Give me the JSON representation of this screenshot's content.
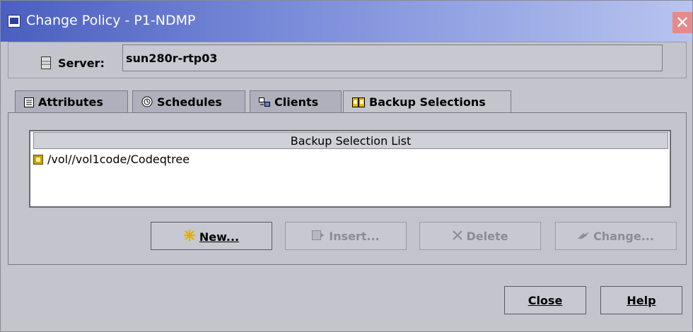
{
  "window": {
    "title": "Change Policy - P1-NDMP",
    "close_glyph": "✕"
  },
  "server": {
    "label": "Server:",
    "value": "sun280r-rtp03",
    "icon": "server-icon"
  },
  "tabs": [
    {
      "label": "Attributes",
      "icon": "attributes-icon",
      "active": false
    },
    {
      "label": "Schedules",
      "icon": "schedules-icon",
      "active": false
    },
    {
      "label": "Clients",
      "icon": "clients-icon",
      "active": false
    },
    {
      "label": "Backup Selections",
      "icon": "backup-selections-icon",
      "active": true
    }
  ],
  "backup_list": {
    "header": "Backup Selection List",
    "items": [
      "/vol//vol1code/Codeqtree"
    ]
  },
  "actions": {
    "new_label": "New...",
    "insert_label": "Insert...",
    "delete_label": "Delete",
    "change_label": "Change..."
  },
  "footer": {
    "close_label": "Close",
    "help_label": "Help"
  },
  "colors": {
    "title_gradient_start": "#4a5fbf",
    "window_bg": "#c4c4cc",
    "close_button": "#e58a8a"
  }
}
